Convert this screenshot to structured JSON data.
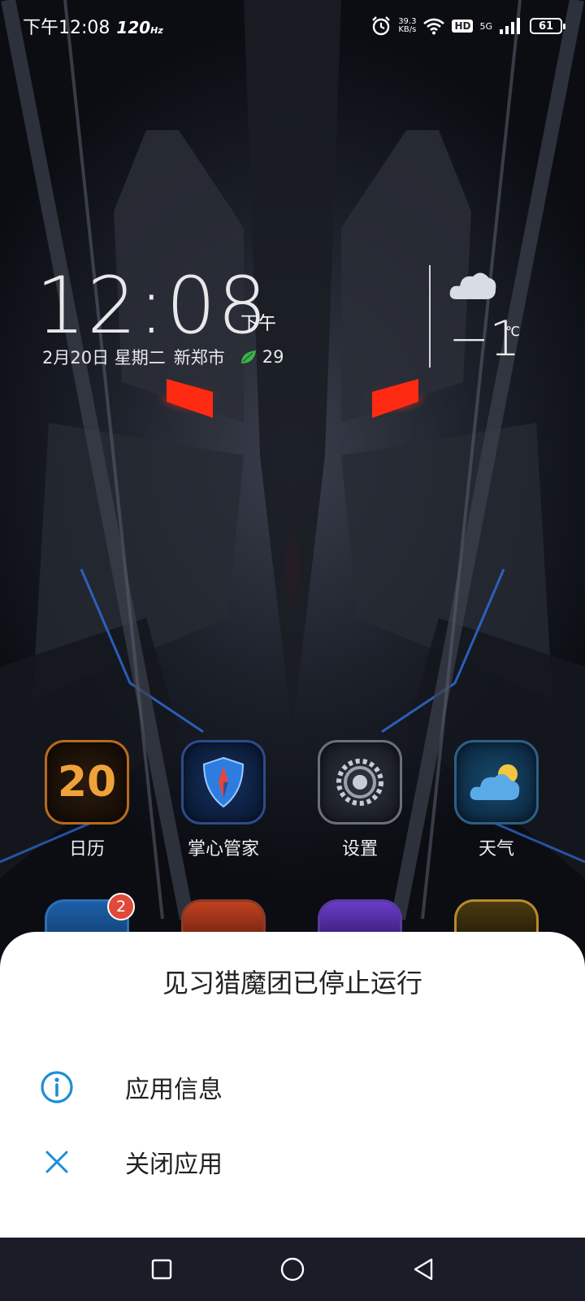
{
  "status_bar": {
    "time": "下午12:08",
    "refresh_rate": "120",
    "refresh_unit": "Hz",
    "net_speed_value": "39.3",
    "net_speed_unit": "KB/s",
    "hd": "HD",
    "network": "5G",
    "battery": "61",
    "icons": [
      "alarm-icon",
      "wifi-icon",
      "signal-icon",
      "battery-icon"
    ]
  },
  "clock_widget": {
    "time": "12:08",
    "ampm": "下午",
    "date": "2月20日 星期二",
    "city": "新郑市",
    "aqi": "29",
    "temperature": "−1",
    "temperature_unit": "℃",
    "weather_icon": "cloud-icon"
  },
  "apps": [
    {
      "label": "日历",
      "icon_text": "20",
      "icon": "calendar-icon"
    },
    {
      "label": "掌心管家",
      "icon": "shield-icon"
    },
    {
      "label": "设置",
      "icon": "gear-icon"
    },
    {
      "label": "天气",
      "icon": "weather-icon"
    }
  ],
  "app_row2_badge": "2",
  "dialog": {
    "title": "见习猎魔团已停止运行",
    "options": [
      {
        "label": "应用信息",
        "icon": "info-icon"
      },
      {
        "label": "关闭应用",
        "icon": "close-icon"
      }
    ],
    "accent_color": "#1a8fd4"
  },
  "nav_bar": {
    "buttons": [
      "recents-button",
      "home-button",
      "back-button"
    ]
  }
}
